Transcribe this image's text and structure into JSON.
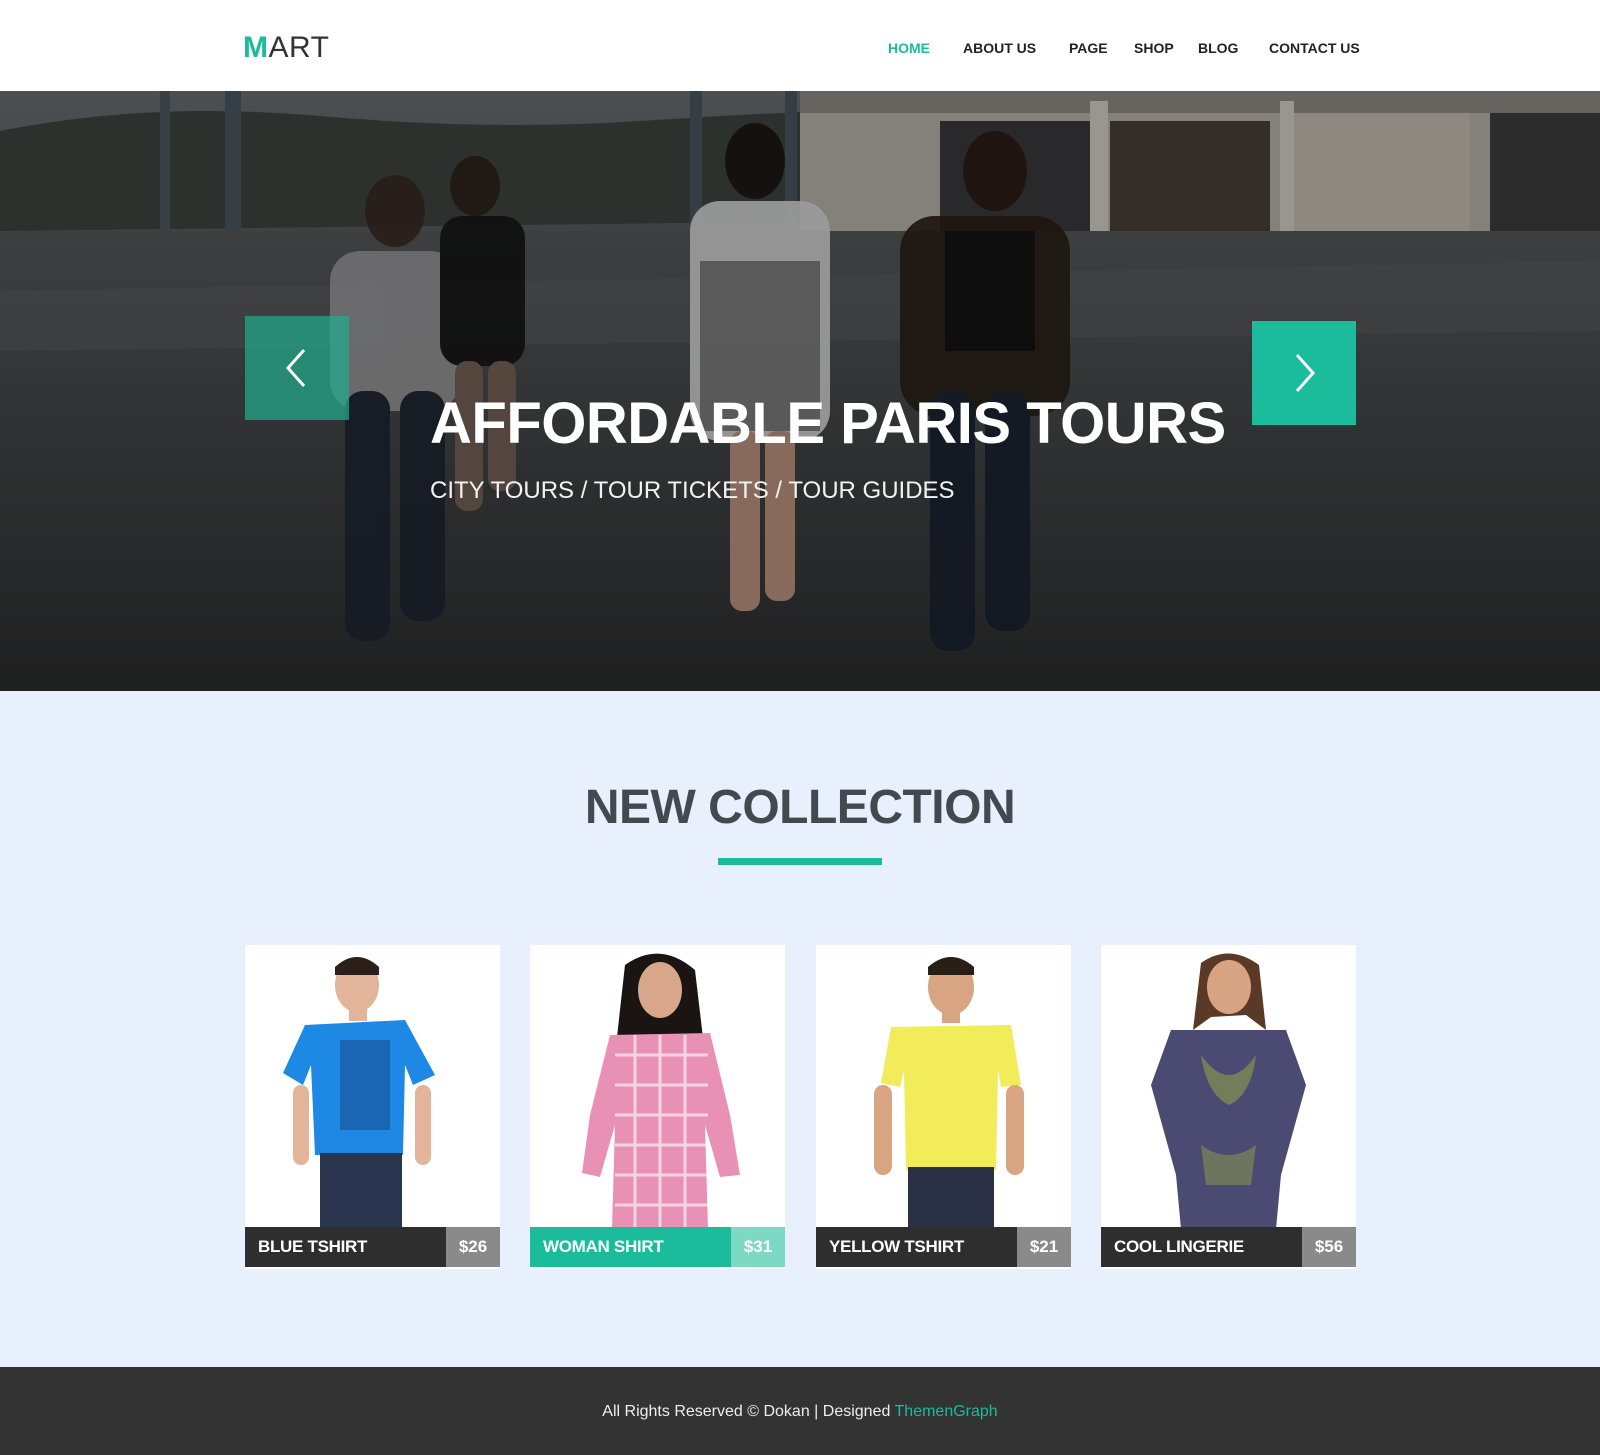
{
  "header": {
    "logo_first": "M",
    "logo_rest": "ART",
    "nav": [
      {
        "label": "HOME",
        "active": true
      },
      {
        "label": "ABOUT US",
        "active": false
      },
      {
        "label": "PAGE",
        "active": false
      },
      {
        "label": "SHOP",
        "active": false
      },
      {
        "label": "BLOG",
        "active": false
      },
      {
        "label": "CONTACT US",
        "active": false
      }
    ]
  },
  "hero": {
    "title": "AFFORDABLE PARIS TOURS",
    "subtitle": "CITY TOURS / TOUR TICKETS / TOUR GUIDES",
    "prev_icon": "chevron-left-icon",
    "next_icon": "chevron-right-icon"
  },
  "collection": {
    "title": "NEW COLLECTION",
    "products": [
      {
        "name": "BLUE TSHIRT",
        "price": "$26",
        "color": "#1e88e5"
      },
      {
        "name": "WOMAN SHIRT",
        "price": "$31",
        "color": "#e991b5"
      },
      {
        "name": "YELLOW TSHIRT",
        "price": "$21",
        "color": "#f2ec5a"
      },
      {
        "name": "COOL LINGERIE",
        "price": "$56",
        "color": "#4b4a73"
      }
    ]
  },
  "footer": {
    "text": "All Rights Reserved © Dokan | Designed",
    "credit": "ThemenGraph"
  },
  "colors": {
    "accent": "#1abc9c",
    "dark": "#333333",
    "page_bg": "#e8effd"
  }
}
